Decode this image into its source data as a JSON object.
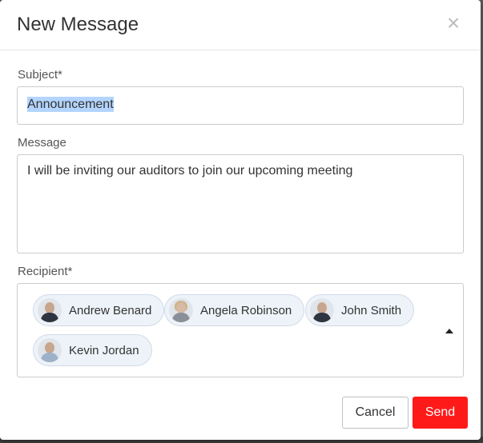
{
  "modal": {
    "title": "New Message",
    "close_symbol": "×"
  },
  "subject": {
    "label": "Subject*",
    "value": "Announcement"
  },
  "message": {
    "label": "Message",
    "value": "I will be inviting our auditors to join our upcoming meeting"
  },
  "recipient": {
    "label": "Recipient*",
    "chips": [
      {
        "name": "Andrew Benard",
        "avatar": "user-avatar-icon"
      },
      {
        "name": "Angela Robinson",
        "avatar": "user-avatar-icon"
      },
      {
        "name": "John Smith",
        "avatar": "user-avatar-icon"
      },
      {
        "name": "Kevin Jordan",
        "avatar": "user-avatar-icon"
      }
    ]
  },
  "buttons": {
    "cancel": "Cancel",
    "send": "Send"
  },
  "colors": {
    "send_button": "#ff1a1a",
    "chip_background": "#eef3f9",
    "selection_highlight": "#b3d4fd"
  }
}
